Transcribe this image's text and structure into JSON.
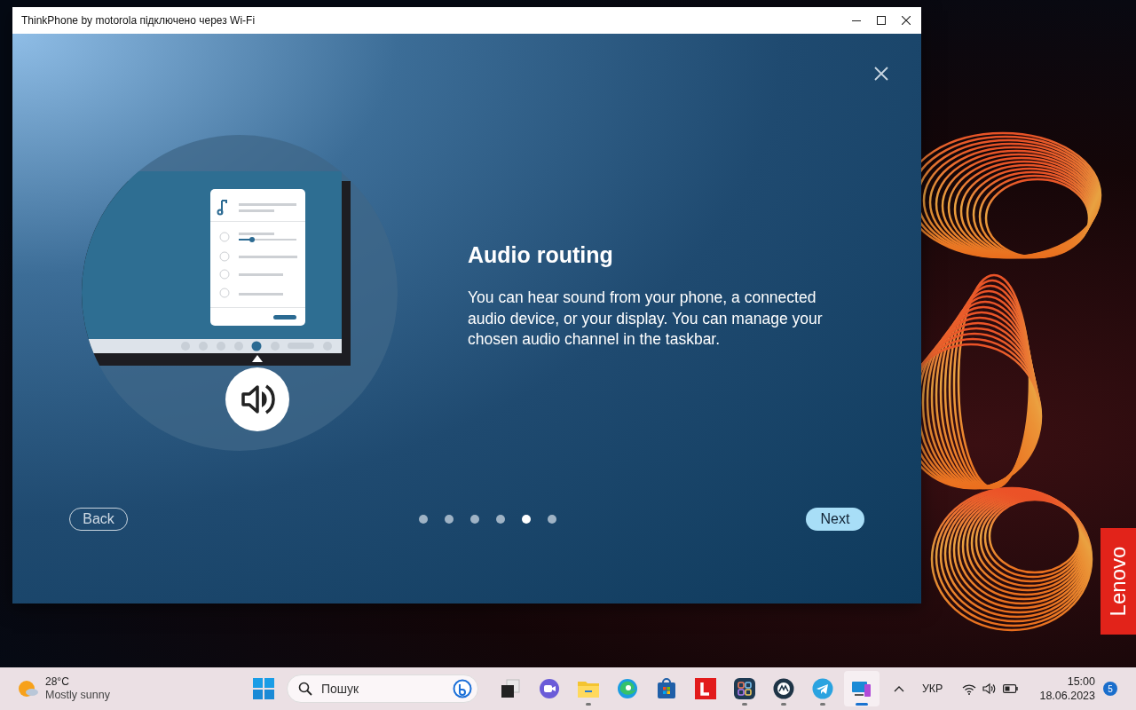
{
  "window": {
    "title": "ThinkPhone by motorola підключено через Wi-Fi"
  },
  "dialog": {
    "heading": "Audio routing",
    "body": "You can hear sound from your phone, a connected audio device, or your display. You can manage your chosen audio channel in the taskbar.",
    "pages": [
      {
        "selected": false
      },
      {
        "selected": false
      },
      {
        "selected": false
      },
      {
        "selected": false
      },
      {
        "selected": true
      },
      {
        "selected": false
      }
    ],
    "back": "Back",
    "next": "Next"
  },
  "wallpaper": {
    "badge": "Lenovo"
  },
  "taskbar": {
    "weather": {
      "temperature": "28°C",
      "condition": "Mostly sunny"
    },
    "search": {
      "placeholder": "Пошук"
    },
    "apps": [
      {
        "kind": "taskview",
        "running": false,
        "selected": false
      },
      {
        "kind": "chat",
        "running": false,
        "selected": false
      },
      {
        "kind": "explorer",
        "running": true,
        "selected": false
      },
      {
        "kind": "edge",
        "running": false,
        "selected": false
      },
      {
        "kind": "store",
        "running": false,
        "selected": false
      },
      {
        "kind": "letter",
        "running": false,
        "selected": false
      },
      {
        "kind": "grid",
        "running": true,
        "selected": false
      },
      {
        "kind": "moto",
        "running": true,
        "selected": false
      },
      {
        "kind": "telegram",
        "running": true,
        "selected": false
      },
      {
        "kind": "phonelink",
        "running": true,
        "selected": true
      }
    ],
    "language": "УКР",
    "time": "15:00",
    "date": "18.06.2023",
    "notifications": "5"
  }
}
